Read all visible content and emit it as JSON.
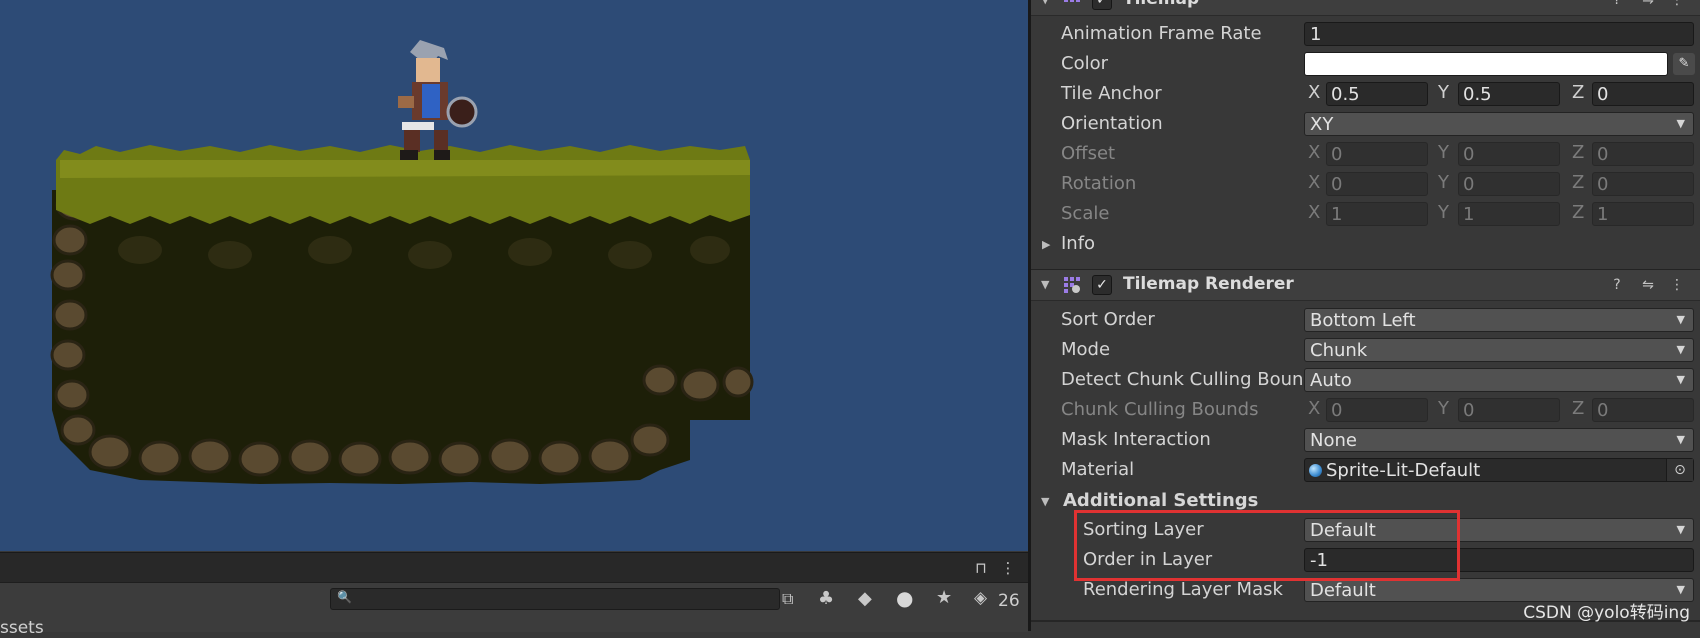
{
  "scene": {
    "background": "#2d4b76",
    "hidden_count": "26",
    "project_label": "ssets"
  },
  "inspector": {
    "tilemap": {
      "title": "Tilemap",
      "animation_frame_rate": {
        "label": "Animation Frame Rate",
        "value": "1"
      },
      "color": {
        "label": "Color",
        "value": "#ffffff"
      },
      "tile_anchor": {
        "label": "Tile Anchor",
        "x": "0.5",
        "y": "0.5",
        "z": "0"
      },
      "orientation": {
        "label": "Orientation",
        "value": "XY"
      },
      "offset": {
        "label": "Offset",
        "x": "0",
        "y": "0",
        "z": "0"
      },
      "rotation": {
        "label": "Rotation",
        "x": "0",
        "y": "0",
        "z": "0"
      },
      "scale": {
        "label": "Scale",
        "x": "1",
        "y": "1",
        "z": "1"
      },
      "info_label": "Info"
    },
    "renderer": {
      "title": "Tilemap Renderer",
      "sort_order": {
        "label": "Sort Order",
        "value": "Bottom Left"
      },
      "mode": {
        "label": "Mode",
        "value": "Chunk"
      },
      "detect_chunk": {
        "label": "Detect Chunk Culling Boun",
        "value": "Auto"
      },
      "chunk_bounds": {
        "label": "Chunk Culling Bounds",
        "x": "0",
        "y": "0",
        "z": "0"
      },
      "mask_interaction": {
        "label": "Mask Interaction",
        "value": "None"
      },
      "material": {
        "label": "Material",
        "value": "Sprite-Lit-Default"
      },
      "additional_settings": "Additional Settings",
      "sorting_layer": {
        "label": "Sorting Layer",
        "value": "Default"
      },
      "order_in_layer": {
        "label": "Order in Layer",
        "value": "-1"
      },
      "rendering_layer_mask": {
        "label": "Rendering Layer Mask",
        "value": "Default"
      }
    },
    "axis_labels": {
      "x": "X",
      "y": "Y",
      "z": "Z"
    }
  },
  "highlight_color": "#e03232",
  "watermark": "CSDN @yolo转码ing"
}
